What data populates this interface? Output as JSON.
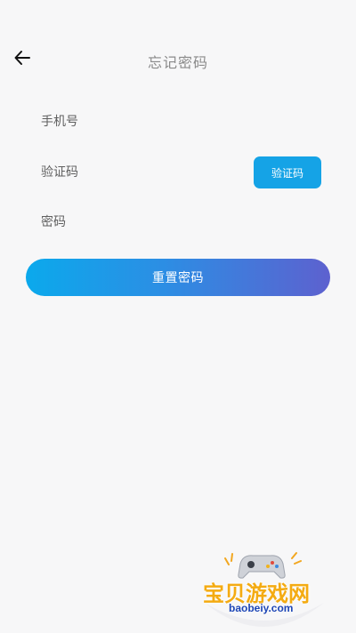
{
  "header": {
    "title": "忘记密码",
    "back_icon": "arrow-left-icon"
  },
  "form": {
    "phone_placeholder": "手机号",
    "code_placeholder": "验证码",
    "code_button_label": "验证码",
    "password_placeholder": "密码"
  },
  "actions": {
    "reset_label": "重置密码"
  },
  "watermark": {
    "main": "宝贝游戏网",
    "sub": "baobeiy.com"
  },
  "colors": {
    "background": "#f7f7f8",
    "accent": "#15a3e6",
    "gradient_start": "#0ba9ec",
    "gradient_end": "#5d61cf"
  }
}
